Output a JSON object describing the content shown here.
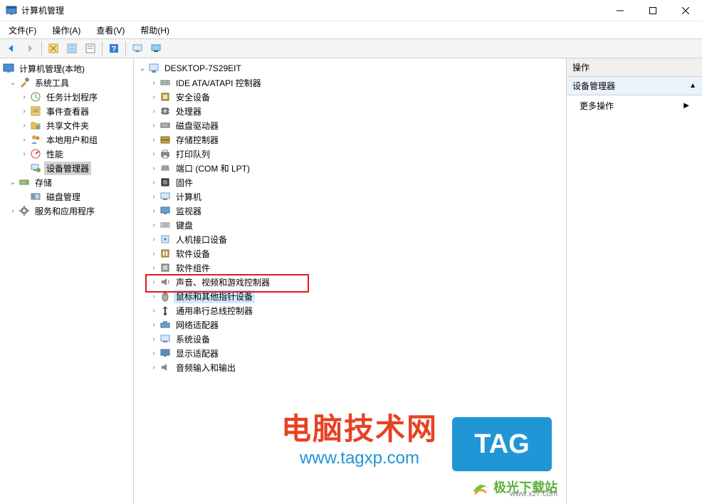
{
  "window": {
    "title": "计算机管理"
  },
  "menu": {
    "file": "文件(F)",
    "action": "操作(A)",
    "view": "查看(V)",
    "help": "帮助(H)"
  },
  "left_tree": {
    "root": "计算机管理(本地)",
    "sys_tools": "系统工具",
    "task_scheduler": "任务计划程序",
    "event_viewer": "事件查看器",
    "shared_folders": "共享文件夹",
    "local_users": "本地用户和组",
    "performance": "性能",
    "device_manager": "设备管理器",
    "storage": "存储",
    "disk_mgmt": "磁盘管理",
    "services_apps": "服务和应用程序"
  },
  "mid_tree": {
    "root": "DESKTOP-7S29EIT",
    "ide": "IDE ATA/ATAPI 控制器",
    "security": "安全设备",
    "cpu": "处理器",
    "disk_drives": "磁盘驱动器",
    "storage_ctrl": "存储控制器",
    "print_queue": "打印队列",
    "ports": "端口 (COM 和 LPT)",
    "firmware": "固件",
    "computer": "计算机",
    "monitor": "监视器",
    "keyboard": "键盘",
    "hid": "人机接口设备",
    "soft_dev": "软件设备",
    "soft_comp": "软件组件",
    "sound": "声音、视频和游戏控制器",
    "mouse": "鼠标和其他指针设备",
    "usb": "通用串行总线控制器",
    "network": "网络适配器",
    "sys_dev": "系统设备",
    "display": "显示适配器",
    "audio_io": "音频输入和输出"
  },
  "actions": {
    "header": "操作",
    "device_mgr": "设备管理器",
    "more": "更多操作"
  },
  "watermark": {
    "line1": "电脑技术网",
    "line2": "www.tagxp.com",
    "tag": "TAG",
    "dlsite": "极光下载站",
    "dlurl": "www.xz7.com"
  }
}
